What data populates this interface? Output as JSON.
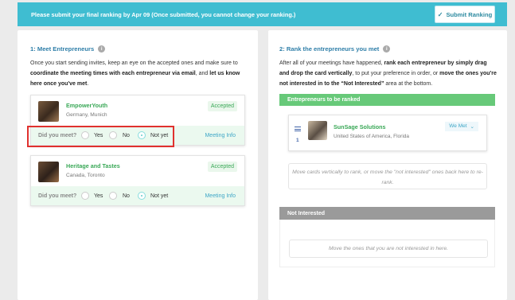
{
  "banner": {
    "text": "Please submit your final ranking by Apr 09 (Once submitted, you cannot change your ranking.)",
    "submit_label": "Submit Ranking",
    "submit_icon": "check-icon"
  },
  "left": {
    "title": "1: Meet Entrepreneurs",
    "intro_1": "Once you start sending invites, keep an eye on the accepted ones and make sure to ",
    "intro_bold_1": "coordinate the meeting times with each entrepreneur via email",
    "intro_2": ", and ",
    "intro_bold_2": "let us know here once you've met",
    "intro_3": ".",
    "meet_label": "Did you meet?",
    "opt_yes": "Yes",
    "opt_no": "No",
    "opt_notyet": "Not yet",
    "meeting_info": "Meeting Info",
    "entrepreneurs": [
      {
        "name": "EmpowerYouth",
        "location": "Germany, Munich",
        "status": "Accepted",
        "selected": "Not yet"
      },
      {
        "name": "Heritage and Tastes",
        "location": "Canada, Toronto",
        "status": "Accepted",
        "selected": "Not yet"
      }
    ]
  },
  "right": {
    "title": "2: Rank the entrepreneurs you met",
    "intro_1": "After all of your meetings have happened, ",
    "intro_bold_1": "rank each entrepreneur by simply drag and drop the card vertically",
    "intro_2": ", to put your preference in order, or ",
    "intro_bold_2": "move the ones you're not interested in to the “Not Interested”",
    "intro_3": " area at the bottom.",
    "ranked_header": "Entrepreneurs to be ranked",
    "ranked": [
      {
        "rank": "1",
        "name": "SunSage Solutions",
        "location": "United States of America, Florida",
        "status": "We Met"
      }
    ],
    "ranked_hint": "Move cards vertically to rank, or move the \"not interested\" ones back here to re-rank.",
    "not_interested_header": "Not Interested",
    "not_interested_hint": "Move the ones that you are not interested in here."
  },
  "colors": {
    "banner": "#3fbdd1",
    "accent_green": "#3aa857",
    "ranked_bar": "#67c979",
    "highlight_border": "#e0312e"
  }
}
